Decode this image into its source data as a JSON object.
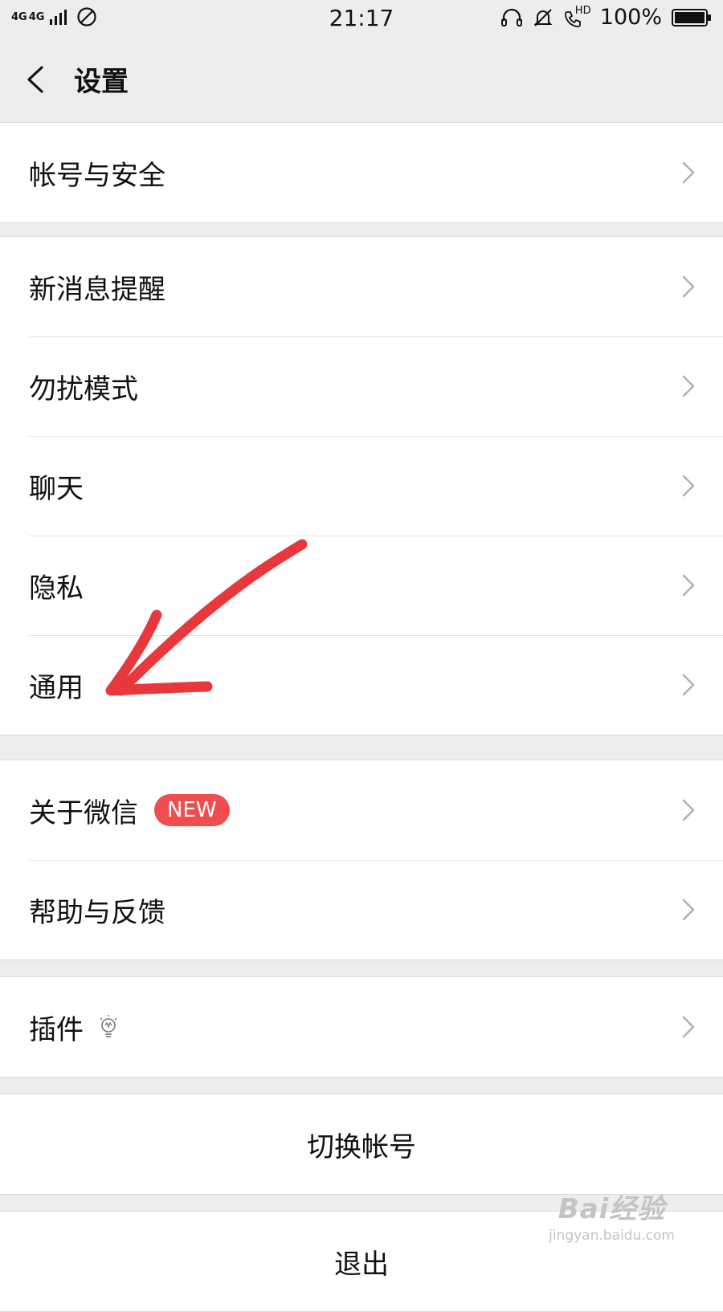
{
  "status_bar": {
    "network_1": "4G",
    "network_2": "4G",
    "time": "21:17",
    "hd_label": "HD",
    "battery": "100%",
    "icons": [
      "signal-icon",
      "do-not-disturb-icon",
      "headphone-icon",
      "muted-bell-icon",
      "hd-call-icon",
      "battery-icon"
    ]
  },
  "nav": {
    "title": "设置",
    "back_icon": "chevron-left-icon"
  },
  "groups": [
    {
      "items": [
        {
          "label": "帐号与安全"
        }
      ]
    },
    {
      "items": [
        {
          "label": "新消息提醒"
        },
        {
          "label": "勿扰模式"
        },
        {
          "label": "聊天"
        },
        {
          "label": "隐私"
        },
        {
          "label": "通用"
        }
      ]
    },
    {
      "items": [
        {
          "label": "关于微信",
          "badge": "NEW"
        },
        {
          "label": "帮助与反馈"
        }
      ]
    },
    {
      "items": [
        {
          "label": "插件",
          "icon": "lightbulb-icon"
        }
      ]
    }
  ],
  "switch_account": "切换帐号",
  "logout": "退出",
  "watermark": {
    "logo": "Bai经验",
    "url": "jingyan.baidu.com"
  },
  "colors": {
    "background": "#ededed",
    "badge": "#f04e4e",
    "annotation_arrow": "#e8383d"
  }
}
